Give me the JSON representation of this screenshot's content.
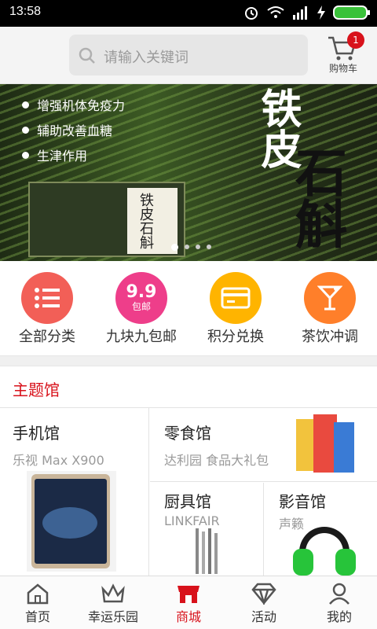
{
  "status": {
    "time": "13:58"
  },
  "header": {
    "search_placeholder": "请输入关键词",
    "cart_label": "购物车",
    "cart_count": "1"
  },
  "banner": {
    "bullets": [
      "增强机体免疫力",
      "辅助改善血糖",
      "生津作用"
    ],
    "title_line1": "铁皮",
    "title_line2": "石斛",
    "box_text": "铁皮石斛",
    "active_dot": 0
  },
  "quick": [
    {
      "label": "全部分类",
      "color": "#f25f57",
      "icon": "list-icon"
    },
    {
      "label": "九块九包邮",
      "color": "#ee3e8a",
      "icon": "nine-nine-icon",
      "badge_top": "9.9",
      "badge_bottom": "包邮"
    },
    {
      "label": "积分兑换",
      "color": "#ffb400",
      "icon": "card-icon"
    },
    {
      "label": "茶饮冲调",
      "color": "#ff7f2a",
      "icon": "cocktail-icon"
    }
  ],
  "section": {
    "title": "主题馆"
  },
  "tiles": {
    "phone": {
      "title": "手机馆",
      "subtitle": "乐视 Max X900"
    },
    "snack": {
      "title": "零食馆",
      "subtitle": "达利园 食品大礼包"
    },
    "kitchen": {
      "title": "厨具馆",
      "subtitle": "LINKFAIR"
    },
    "audio": {
      "title": "影音馆",
      "subtitle": "声籁"
    }
  },
  "bottom_nav": [
    {
      "label": "首页",
      "icon": "home-icon"
    },
    {
      "label": "幸运乐园",
      "icon": "crown-icon"
    },
    {
      "label": "商城",
      "icon": "shop-icon",
      "active": true
    },
    {
      "label": "活动",
      "icon": "diamond-icon"
    },
    {
      "label": "我的",
      "icon": "person-icon"
    }
  ],
  "colors": {
    "accent": "#d8121b"
  }
}
